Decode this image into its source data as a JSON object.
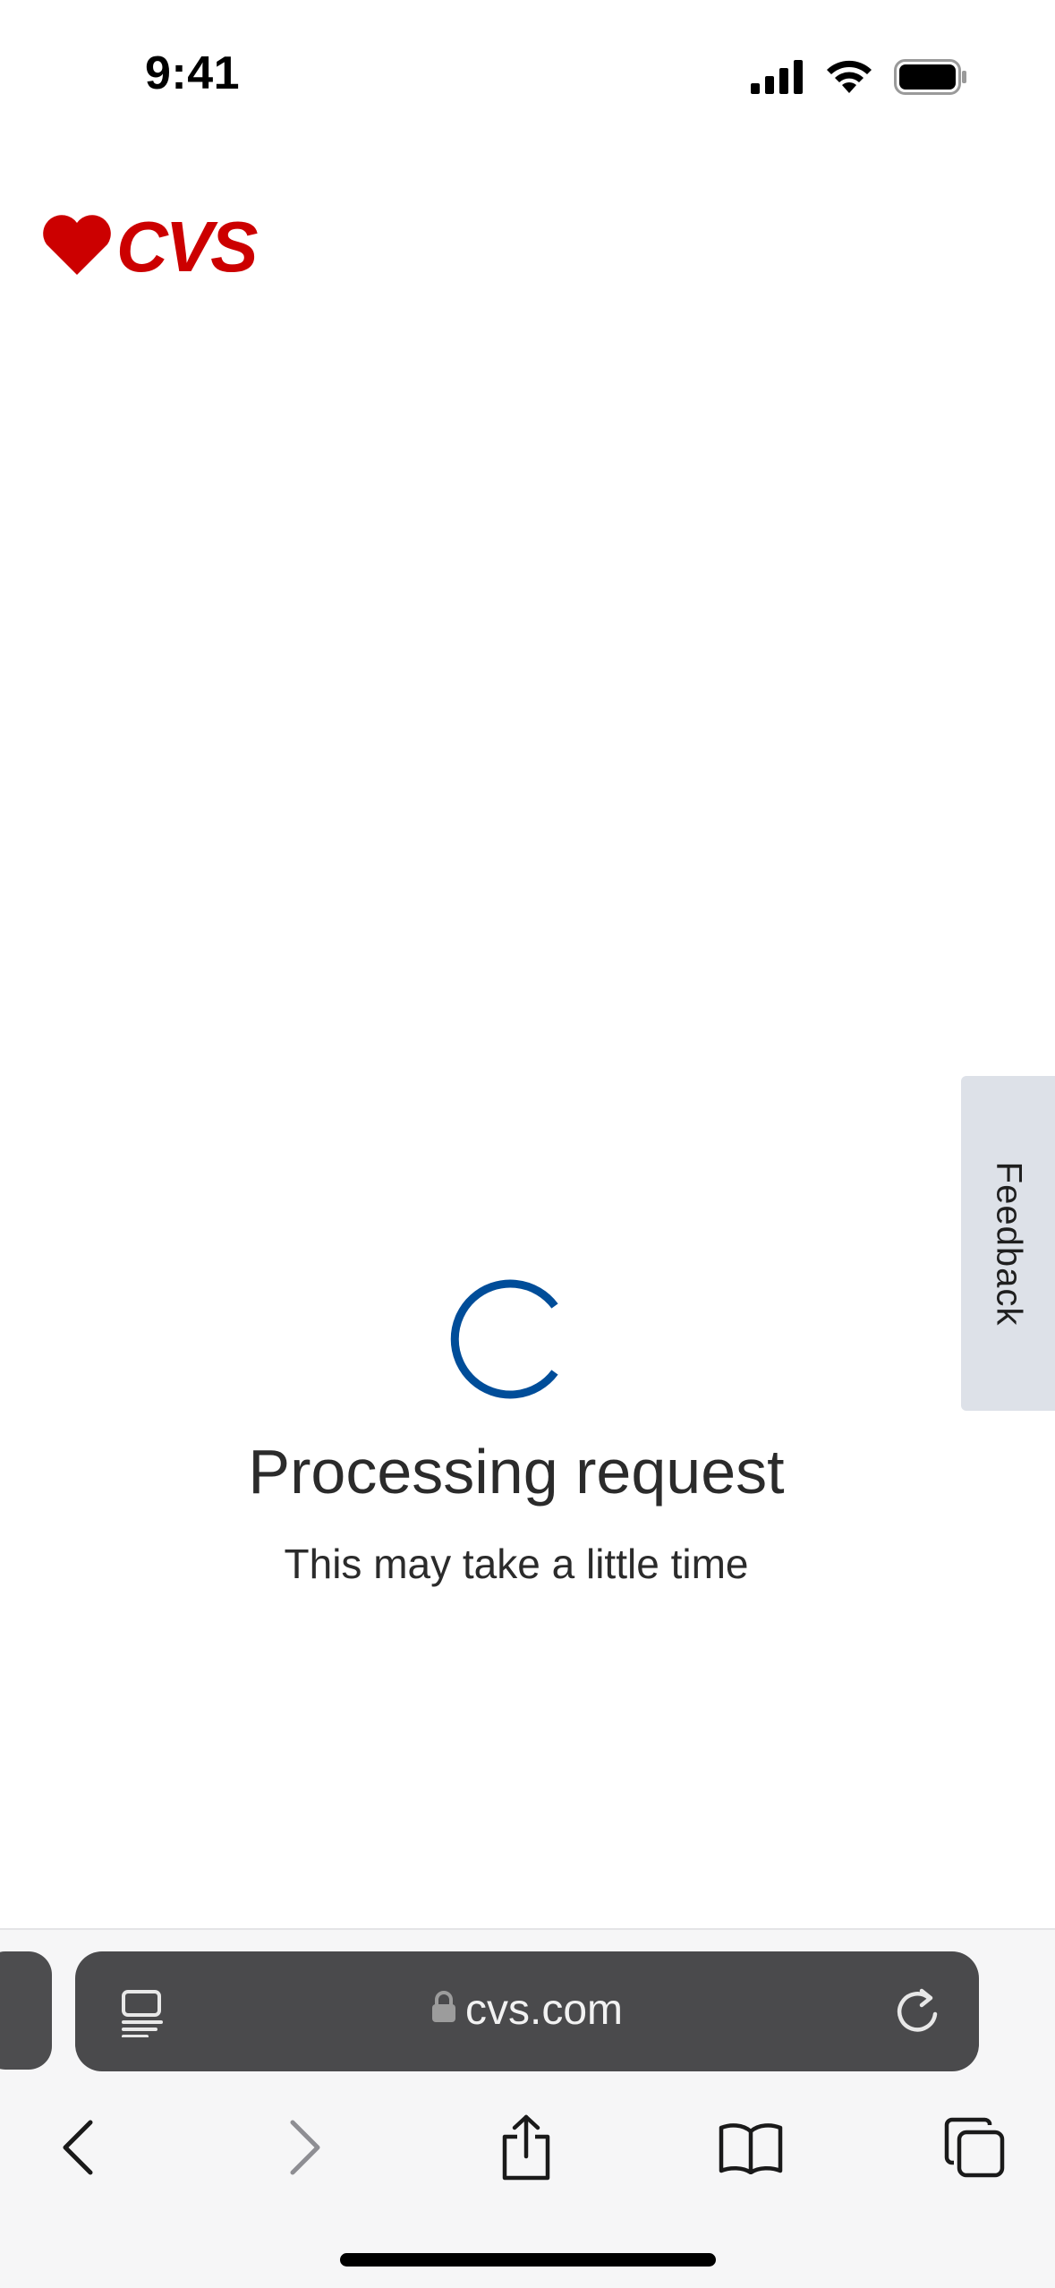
{
  "status_bar": {
    "time": "9:41"
  },
  "brand": {
    "name": "CVS",
    "color": "#cc0000"
  },
  "feedback_tab": {
    "label": "Feedback"
  },
  "loader": {
    "title": "Processing request",
    "subtitle": "This may take a little time",
    "spinner_color": "#004d99"
  },
  "browser": {
    "url": "cvs.com",
    "icons": [
      "reader-icon",
      "lock-icon",
      "reload-icon",
      "back-icon",
      "forward-icon",
      "share-icon",
      "bookmarks-icon",
      "tabs-icon"
    ]
  }
}
